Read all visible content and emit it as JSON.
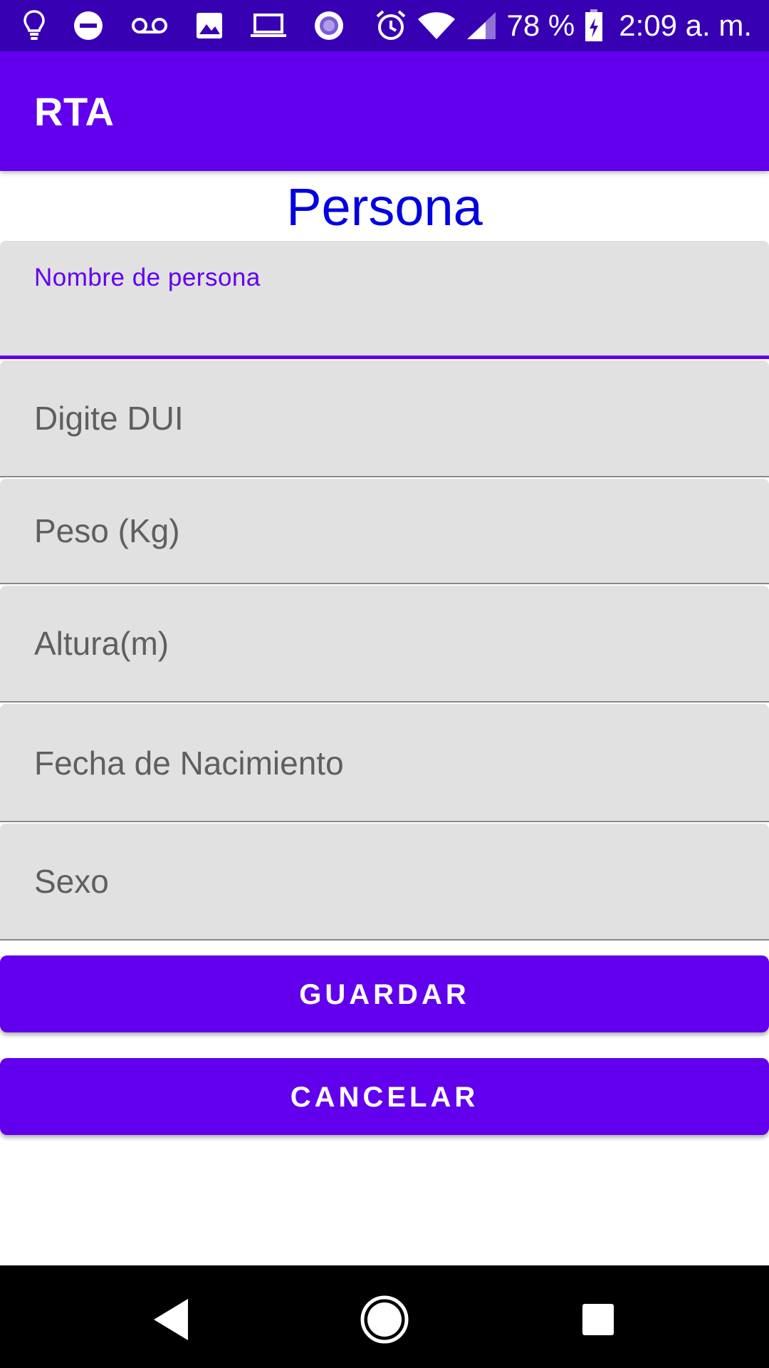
{
  "status_bar": {
    "battery_text": "78 %",
    "time": "2:09 a. m.",
    "icons": [
      "lightbulb-icon",
      "do-not-disturb-icon",
      "voicemail-icon",
      "image-icon",
      "laptop-icon",
      "record-icon",
      "alarm-icon",
      "wifi-icon",
      "cell-signal-icon",
      "battery-charging-icon"
    ]
  },
  "app_bar": {
    "title": "RTA"
  },
  "page": {
    "heading": "Persona"
  },
  "form": {
    "fields": [
      {
        "label": "Nombre de persona",
        "value": ""
      },
      {
        "placeholder": "Digite DUI"
      },
      {
        "placeholder": "Peso (Kg)"
      },
      {
        "placeholder": "Altura(m)"
      },
      {
        "placeholder": "Fecha de Nacimiento"
      },
      {
        "placeholder": "Sexo"
      }
    ]
  },
  "buttons": {
    "save": "GUARDAR",
    "cancel": "CANCELAR"
  },
  "nav_bar": {
    "icons": [
      "back-icon",
      "home-icon",
      "recents-icon"
    ]
  },
  "colors": {
    "status_bar": "#3700b3",
    "primary": "#6200ee",
    "heading": "#0000e0",
    "field_background": "#e1e1e1",
    "placeholder": "#5f5f5f"
  }
}
